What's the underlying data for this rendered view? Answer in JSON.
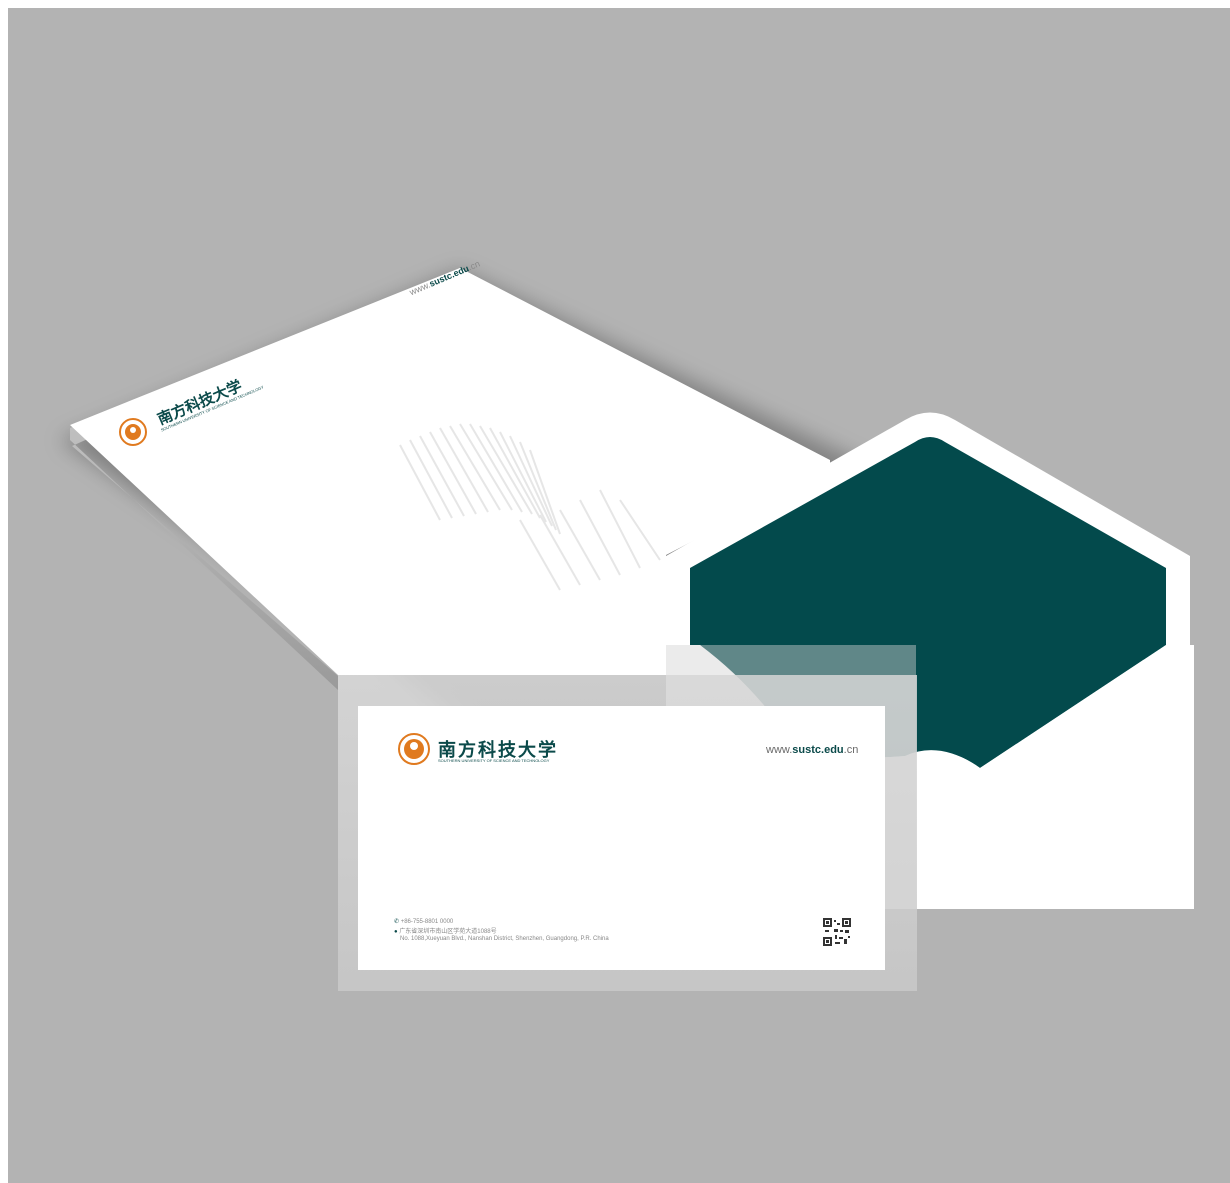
{
  "letterhead": {
    "website_prefix": "www.",
    "website_domain": "sustc.edu",
    "website_suffix": ".cn",
    "university_name_cn": "南方科技大学",
    "university_name_en": "SOUTHERN UNIVERSITY OF SCIENCE AND TECHNOLOGY",
    "seal_text": "南方科技大学"
  },
  "envelope": {
    "website_prefix": "www.",
    "website_domain": "sustc.edu",
    "website_suffix": ".cn",
    "university_name_cn": "南方科技大学",
    "university_name_en": "SOUTHERN UNIVERSITY OF SCIENCE AND TECHNOLOGY",
    "phone": "+86-755-8801 0000",
    "address_cn": "广东省深圳市南山区学苑大道1088号",
    "address_en": "No. 1088,Xueyuan Blvd., Nanshan District, Shenzhen, Guangdong, P.R. China",
    "seal_text": "南方科技大学"
  },
  "colors": {
    "background": "#b3b3b3",
    "brand_green": "#034a4c",
    "brand_orange": "#e07a1f",
    "paper": "#ffffff"
  }
}
